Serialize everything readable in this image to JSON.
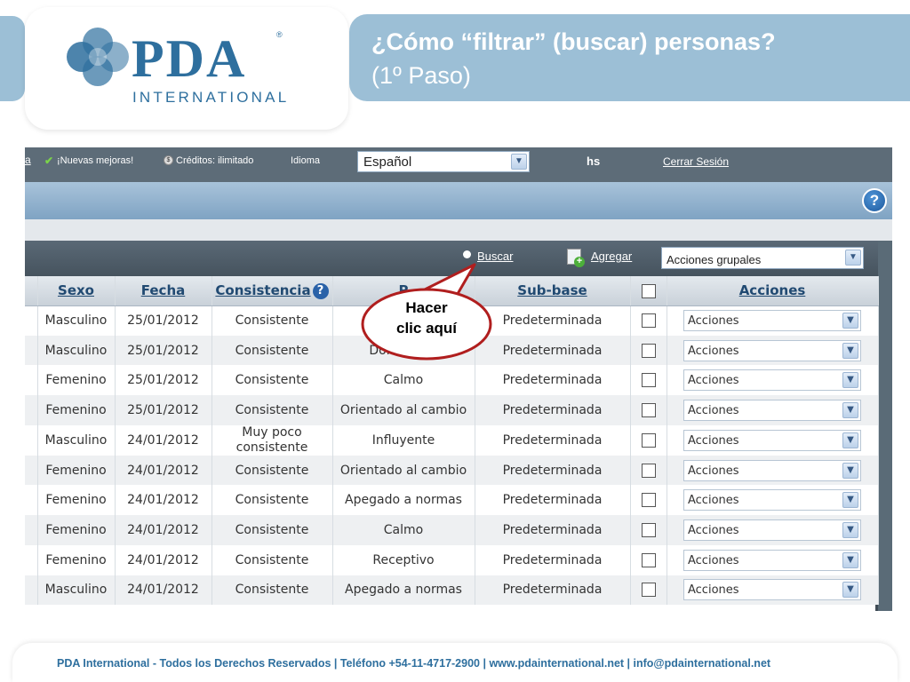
{
  "slide": {
    "title_line1": "¿Cómo “filtrar” (buscar) personas?",
    "title_line2": "(1º Paso)",
    "logo": {
      "word": "PDA",
      "registered": "®",
      "sub": "INTERNATIONAL"
    },
    "footer": "PDA International - Todos los Derechos Reservados | Teléfono +54-11-4717-2900 | www.pdainternational.net  | info@pdainternational.net"
  },
  "topbar": {
    "link_fragment": "a",
    "news": "¡Nuevas mejoras!",
    "credits": "Créditos: ilimitado",
    "language_label": "Idioma",
    "language_value": "Español",
    "user": "hs",
    "logout": "Cerrar Sesión"
  },
  "toolbar": {
    "search": "Buscar",
    "add": "Agregar",
    "group_actions": "Acciones grupales"
  },
  "table": {
    "headers": {
      "sexo": "Sexo",
      "fecha": "Fecha",
      "consistencia": "Consistencia",
      "perfil": "P",
      "subbase": "Sub-base",
      "acciones": "Acciones"
    },
    "rows": [
      {
        "sexo": "Masculino",
        "fecha": "25/01/2012",
        "consistencia": "Consistente",
        "perfil": "Ori",
        "subbase": "Predeterminada",
        "accion": "Acciones"
      },
      {
        "sexo": "Masculino",
        "fecha": "25/01/2012",
        "consistencia": "Consistente",
        "perfil": "Dominante",
        "subbase": "Predeterminada",
        "accion": "Acciones"
      },
      {
        "sexo": "Femenino",
        "fecha": "25/01/2012",
        "consistencia": "Consistente",
        "perfil": "Calmo",
        "subbase": "Predeterminada",
        "accion": "Acciones"
      },
      {
        "sexo": "Femenino",
        "fecha": "25/01/2012",
        "consistencia": "Consistente",
        "perfil": "Orientado al cambio",
        "subbase": "Predeterminada",
        "accion": "Acciones"
      },
      {
        "sexo": "Masculino",
        "fecha": "24/01/2012",
        "consistencia": "Muy poco consistente",
        "perfil": "Influyente",
        "subbase": "Predeterminada",
        "accion": "Acciones"
      },
      {
        "sexo": "Femenino",
        "fecha": "24/01/2012",
        "consistencia": "Consistente",
        "perfil": "Orientado al cambio",
        "subbase": "Predeterminada",
        "accion": "Acciones"
      },
      {
        "sexo": "Femenino",
        "fecha": "24/01/2012",
        "consistencia": "Consistente",
        "perfil": "Apegado a normas",
        "subbase": "Predeterminada",
        "accion": "Acciones"
      },
      {
        "sexo": "Femenino",
        "fecha": "24/01/2012",
        "consistencia": "Consistente",
        "perfil": "Calmo",
        "subbase": "Predeterminada",
        "accion": "Acciones"
      },
      {
        "sexo": "Femenino",
        "fecha": "24/01/2012",
        "consistencia": "Consistente",
        "perfil": "Receptivo",
        "subbase": "Predeterminada",
        "accion": "Acciones"
      },
      {
        "sexo": "Masculino",
        "fecha": "24/01/2012",
        "consistencia": "Consistente",
        "perfil": "Apegado a normas",
        "subbase": "Predeterminada",
        "accion": "Acciones"
      }
    ]
  },
  "callout": {
    "line1": "Hacer",
    "line2": "clic aquí"
  },
  "colors": {
    "band": "#9cbfd6",
    "brand": "#2e6f9e",
    "callout_border": "#b01e1e",
    "header_text": "#214a72"
  },
  "icons": [
    "check-icon",
    "credits-coin-icon",
    "help-icon",
    "search-dot-icon",
    "add-person-icon",
    "dropdown-arrow-icon",
    "help-question-icon"
  ]
}
